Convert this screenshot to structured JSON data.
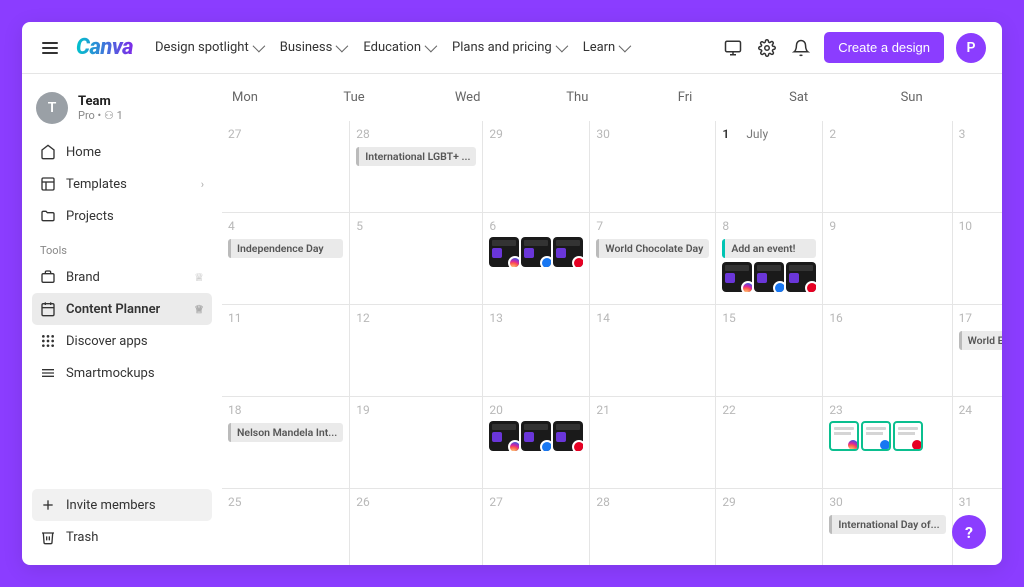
{
  "topbar": {
    "logo": "Canva",
    "nav": [
      "Design spotlight",
      "Business",
      "Education",
      "Plans and pricing",
      "Learn"
    ],
    "create": "Create a design",
    "avatar_initial": "P"
  },
  "sidebar": {
    "team_initial": "T",
    "team_name": "Team",
    "team_sub": "Pro • ⚇ 1",
    "items": [
      {
        "label": "Home"
      },
      {
        "label": "Templates",
        "chevron": true
      },
      {
        "label": "Projects"
      }
    ],
    "tools_label": "Tools",
    "tools": [
      {
        "label": "Brand",
        "crown": true
      },
      {
        "label": "Content Planner",
        "crown": true,
        "active": true
      },
      {
        "label": "Discover apps"
      },
      {
        "label": "Smartmockups"
      }
    ],
    "invite": "Invite members",
    "trash": "Trash"
  },
  "calendar": {
    "headers": [
      "Mon",
      "Tue",
      "Wed",
      "Thu",
      "Fri",
      "Sat",
      "Sun"
    ],
    "month_label": "July",
    "days": [
      {
        "n": "27",
        "prev": true
      },
      {
        "n": "28",
        "prev": true,
        "pill": "International LGBT+ ..."
      },
      {
        "n": "29",
        "prev": true
      },
      {
        "n": "30",
        "prev": true
      },
      {
        "n": "1",
        "first": true
      },
      {
        "n": "2"
      },
      {
        "n": "3"
      },
      {
        "n": "4",
        "pill": "Independence Day"
      },
      {
        "n": "5"
      },
      {
        "n": "6",
        "thumbs": "dark"
      },
      {
        "n": "7",
        "pill": "World Chocolate Day"
      },
      {
        "n": "8",
        "pill": "Add an event!",
        "teal": true,
        "thumbs": "dark"
      },
      {
        "n": "9"
      },
      {
        "n": "10"
      },
      {
        "n": "11"
      },
      {
        "n": "12"
      },
      {
        "n": "13"
      },
      {
        "n": "14"
      },
      {
        "n": "15"
      },
      {
        "n": "16"
      },
      {
        "n": "17",
        "pill": "World Emoji Day"
      },
      {
        "n": "18",
        "pill": "Nelson Mandela Int..."
      },
      {
        "n": "19"
      },
      {
        "n": "20",
        "thumbs": "dark"
      },
      {
        "n": "21"
      },
      {
        "n": "22"
      },
      {
        "n": "23",
        "thumbs": "paper"
      },
      {
        "n": "24"
      },
      {
        "n": "25"
      },
      {
        "n": "26"
      },
      {
        "n": "27"
      },
      {
        "n": "28"
      },
      {
        "n": "29"
      },
      {
        "n": "30",
        "pill": "International Day of..."
      },
      {
        "n": "31"
      }
    ]
  },
  "fab": "?"
}
